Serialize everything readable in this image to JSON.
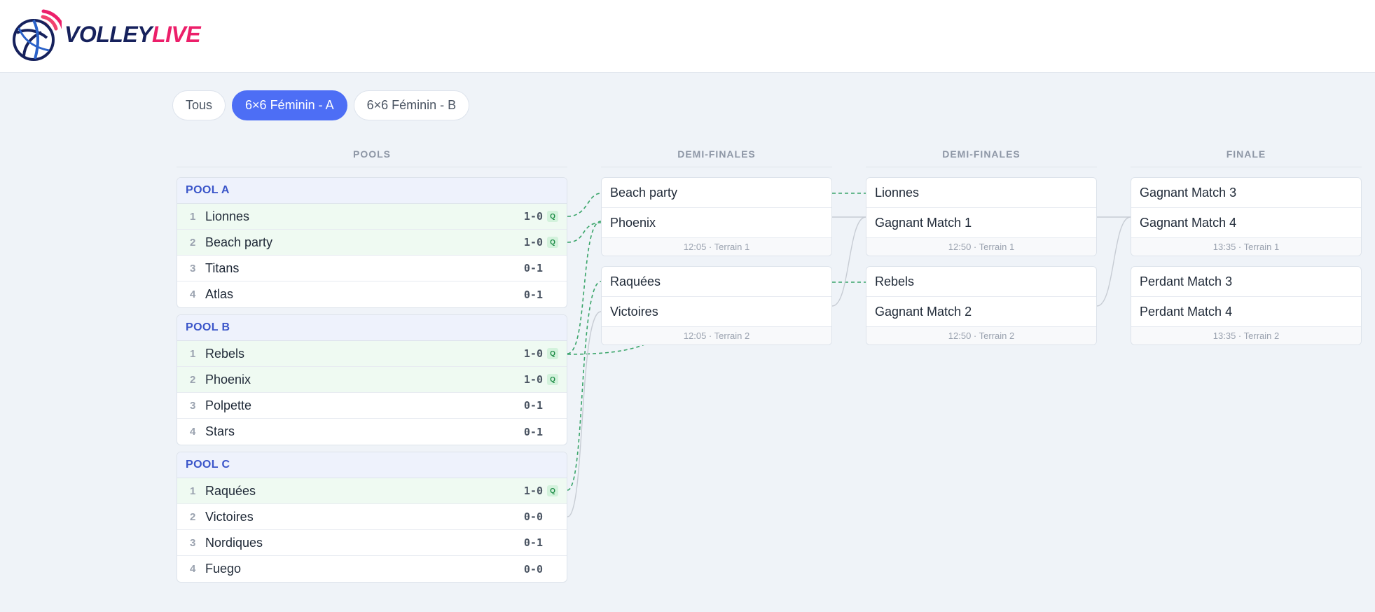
{
  "brand": {
    "part1": "VOLLEY",
    "part2": "LIVE"
  },
  "filters": [
    {
      "label": "Tous",
      "active": false
    },
    {
      "label": "6×6 Féminin - A",
      "active": true
    },
    {
      "label": "6×6 Féminin - B",
      "active": false
    }
  ],
  "columns": {
    "pools": "POOLS",
    "semis1": "DEMI-FINALES",
    "semis2": "DEMI-FINALES",
    "final": "FINALE"
  },
  "pools": [
    {
      "name": "POOL A",
      "rows": [
        {
          "rank": "1",
          "team": "Lionnes",
          "record": "1-0",
          "q": "Q"
        },
        {
          "rank": "2",
          "team": "Beach party",
          "record": "1-0",
          "q": "Q"
        },
        {
          "rank": "3",
          "team": "Titans",
          "record": "0-1",
          "q": ""
        },
        {
          "rank": "4",
          "team": "Atlas",
          "record": "0-1",
          "q": ""
        }
      ]
    },
    {
      "name": "POOL B",
      "rows": [
        {
          "rank": "1",
          "team": "Rebels",
          "record": "1-0",
          "q": "Q"
        },
        {
          "rank": "2",
          "team": "Phoenix",
          "record": "1-0",
          "q": "Q"
        },
        {
          "rank": "3",
          "team": "Polpette",
          "record": "0-1",
          "q": ""
        },
        {
          "rank": "4",
          "team": "Stars",
          "record": "0-1",
          "q": ""
        }
      ]
    },
    {
      "name": "POOL C",
      "rows": [
        {
          "rank": "1",
          "team": "Raquées",
          "record": "1-0",
          "q": "Q"
        },
        {
          "rank": "2",
          "team": "Victoires",
          "record": "0-0",
          "q": ""
        },
        {
          "rank": "3",
          "team": "Nordiques",
          "record": "0-1",
          "q": ""
        },
        {
          "rank": "4",
          "team": "Fuego",
          "record": "0-0",
          "q": ""
        }
      ]
    }
  ],
  "matches": [
    {
      "id": "m1",
      "team1": "Beach party",
      "team2": "Phoenix",
      "meta": "12:05 · Terrain 1"
    },
    {
      "id": "m2",
      "team1": "Raquées",
      "team2": "Victoires",
      "meta": "12:05 · Terrain 2"
    },
    {
      "id": "m3",
      "team1": "Lionnes",
      "team2": "Gagnant Match 1",
      "meta": "12:50 · Terrain 1"
    },
    {
      "id": "m4",
      "team1": "Rebels",
      "team2": "Gagnant Match 2",
      "meta": "12:50 · Terrain 2"
    },
    {
      "id": "m5",
      "team1": "Gagnant Match 3",
      "team2": "Gagnant Match 4",
      "meta": "13:35 · Terrain 1"
    },
    {
      "id": "m6",
      "team1": "Perdant Match 3",
      "team2": "Perdant Match 4",
      "meta": "13:35 · Terrain 2"
    }
  ],
  "colors": {
    "accent": "#4d6ef5",
    "qualified": "#3aa56a",
    "link": "#c7ccd4"
  }
}
